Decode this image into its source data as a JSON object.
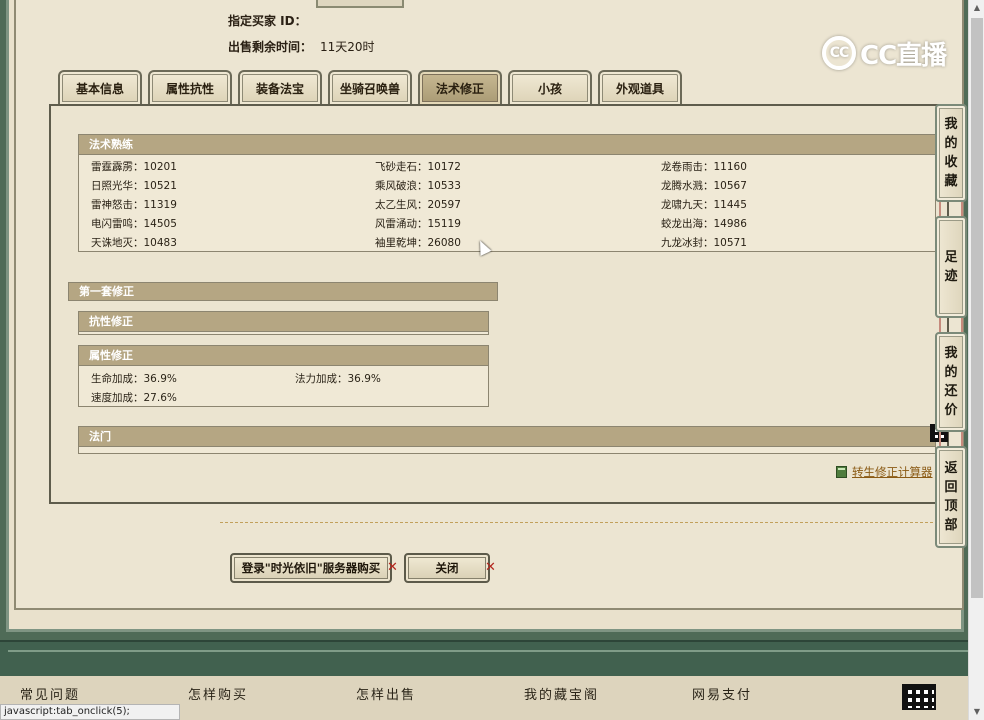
{
  "meta": {
    "buyer_label": "指定买家 ID：",
    "buyer_value": "",
    "time_label": "出售剩余时间：",
    "time_value": "11天20时"
  },
  "logo": {
    "text": "CC直播",
    "icon": "cc-logo-icon"
  },
  "tabs": [
    {
      "label": "基本信息"
    },
    {
      "label": "属性抗性"
    },
    {
      "label": "装备法宝"
    },
    {
      "label": "坐骑召唤兽"
    },
    {
      "label": "法术修正",
      "active": true
    },
    {
      "label": "小孩"
    },
    {
      "label": "外观道具"
    }
  ],
  "skills_section": {
    "title": "法术熟练",
    "rows": [
      [
        "雷霆霹雳：10201",
        "飞砂走石：10172",
        "龙卷雨击：11160"
      ],
      [
        "日照光华：10521",
        "乘风破浪：10533",
        "龙腾水溅：10567"
      ],
      [
        "雷神怒击：11319",
        "太乙生风：20597",
        "龙啸九天：11445"
      ],
      [
        "电闪雷鸣：14505",
        "风雷涌动：15119",
        "蛟龙出海：14986"
      ],
      [
        "天诛地灭：10483",
        "袖里乾坤：26080",
        "九龙冰封：10571"
      ]
    ]
  },
  "group_title": "第一套修正",
  "resist_section": {
    "title": "抗性修正"
  },
  "attr_section": {
    "title": "属性修正",
    "items": [
      "生命加成：36.9%",
      "法力加成：36.9%",
      "速度加成：27.6%"
    ]
  },
  "fa_section": {
    "title": "法门"
  },
  "calc_link": "转生修正计算器",
  "buttons": {
    "buy": "登录\"时光依旧\"服务器购买",
    "close": "关闭"
  },
  "float_nav": [
    {
      "label": "我的收藏",
      "chars": [
        "我",
        "的",
        "收",
        "藏"
      ]
    },
    {
      "label": "足迹",
      "chars": [
        "足",
        "迹"
      ]
    },
    {
      "label": "我的还价",
      "chars": [
        "我",
        "的",
        "还",
        "价"
      ]
    },
    {
      "label": "返回顶部",
      "chars": [
        "返",
        "回",
        "顶",
        "部"
      ]
    }
  ],
  "footer_links": [
    "常见问题",
    "怎样购买",
    "怎样出售",
    "我的藏宝阁",
    "网易支付"
  ],
  "status_text": "javascript:tab_onclick(5);",
  "colors": {
    "header_bar": "#b5a683",
    "frame_green": "#4f6b57",
    "link_brown": "#8a5a14",
    "close_x": "#b3261e"
  }
}
